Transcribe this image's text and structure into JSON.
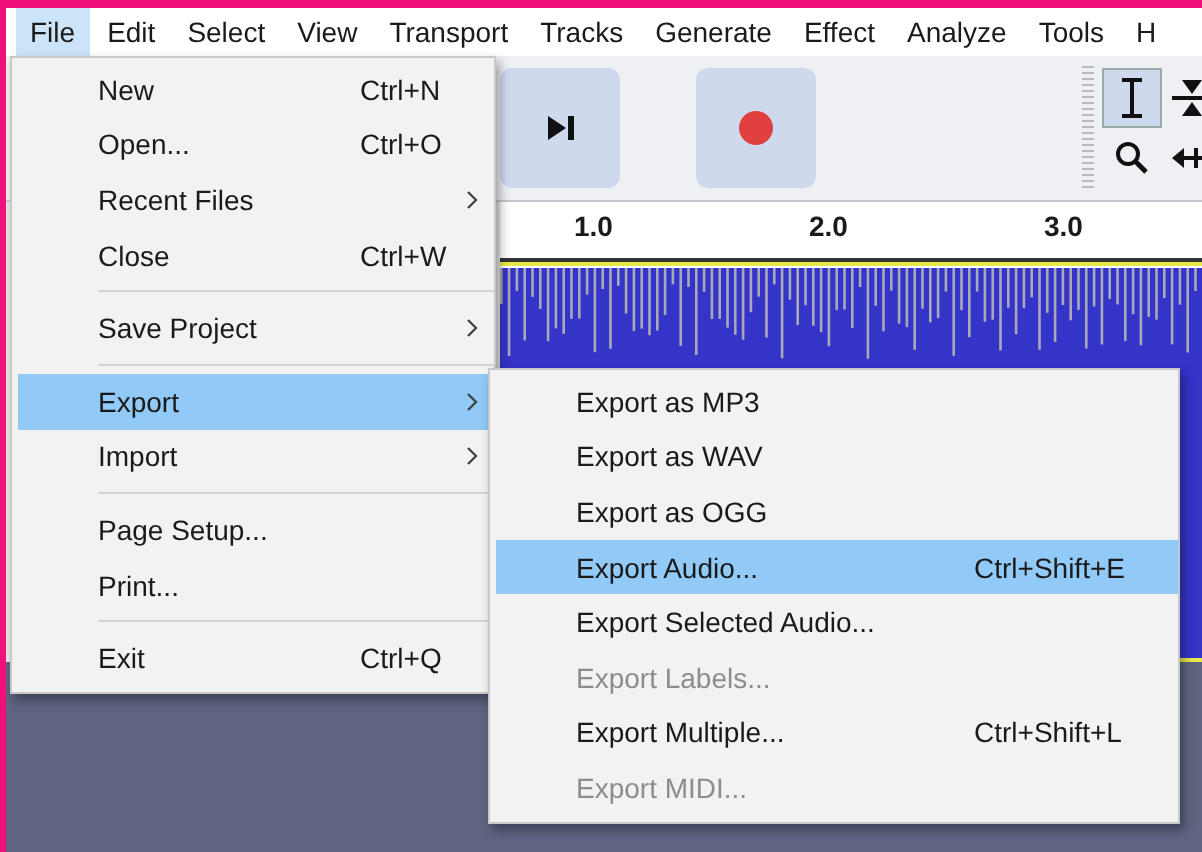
{
  "menubar": [
    {
      "label": "File",
      "selected": true
    },
    {
      "label": "Edit",
      "selected": false
    },
    {
      "label": "Select",
      "selected": false
    },
    {
      "label": "View",
      "selected": false
    },
    {
      "label": "Transport",
      "selected": false
    },
    {
      "label": "Tracks",
      "selected": false
    },
    {
      "label": "Generate",
      "selected": false
    },
    {
      "label": "Effect",
      "selected": false
    },
    {
      "label": "Analyze",
      "selected": false
    },
    {
      "label": "Tools",
      "selected": false
    },
    {
      "label": "H",
      "selected": false
    }
  ],
  "ruler": {
    "ticks": [
      "1.0",
      "2.0",
      "3.0"
    ]
  },
  "file_menu": {
    "items": [
      {
        "kind": "item",
        "label": "New",
        "shortcut": "Ctrl+N",
        "submenu": false,
        "selected": false
      },
      {
        "kind": "item",
        "label": "Open...",
        "shortcut": "Ctrl+O",
        "submenu": false,
        "selected": false
      },
      {
        "kind": "item",
        "label": "Recent Files",
        "submenu": true,
        "selected": false
      },
      {
        "kind": "item",
        "label": "Close",
        "shortcut": "Ctrl+W",
        "submenu": false,
        "selected": false
      },
      {
        "kind": "separator"
      },
      {
        "kind": "item",
        "label": "Save Project",
        "submenu": true,
        "selected": false
      },
      {
        "kind": "separator"
      },
      {
        "kind": "item",
        "label": "Export",
        "submenu": true,
        "selected": true
      },
      {
        "kind": "item",
        "label": "Import",
        "submenu": true,
        "selected": false
      },
      {
        "kind": "separator"
      },
      {
        "kind": "item",
        "label": "Page Setup...",
        "submenu": false,
        "selected": false
      },
      {
        "kind": "item",
        "label": "Print...",
        "submenu": false,
        "selected": false
      },
      {
        "kind": "separator"
      },
      {
        "kind": "item",
        "label": "Exit",
        "shortcut": "Ctrl+Q",
        "submenu": false,
        "selected": false
      }
    ]
  },
  "export_menu": {
    "items": [
      {
        "label": "Export as MP3",
        "disabled": false,
        "selected": false
      },
      {
        "label": "Export as WAV",
        "disabled": false,
        "selected": false
      },
      {
        "label": "Export as OGG",
        "disabled": false,
        "selected": false
      },
      {
        "label": "Export Audio...",
        "shortcut": "Ctrl+Shift+E",
        "disabled": false,
        "selected": true
      },
      {
        "label": "Export Selected Audio...",
        "disabled": false,
        "selected": false
      },
      {
        "label": "Export Labels...",
        "disabled": true,
        "selected": false
      },
      {
        "label": "Export Multiple...",
        "shortcut": "Ctrl+Shift+L",
        "disabled": false,
        "selected": false
      },
      {
        "label": "Export MIDI...",
        "disabled": true,
        "selected": false
      }
    ]
  }
}
